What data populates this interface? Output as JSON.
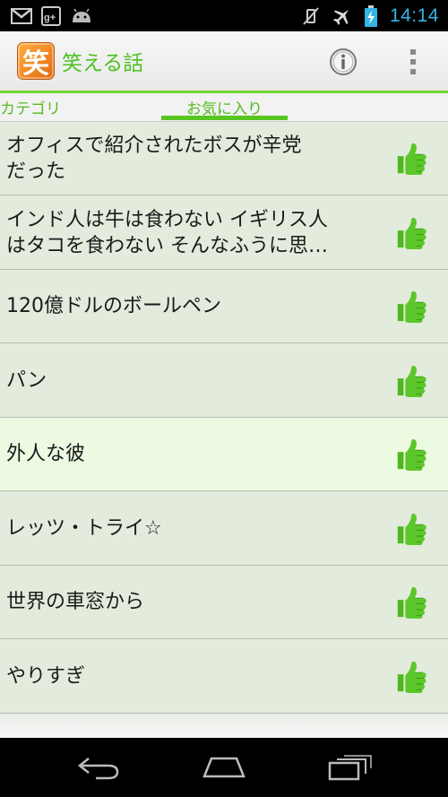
{
  "status_bar": {
    "time": "14:14",
    "left_icons": [
      "gmail-icon",
      "google-plus-icon",
      "android-icon"
    ],
    "right_icons": [
      "vibrate-mute-icon",
      "airplane-mode-icon",
      "battery-charging-icon"
    ]
  },
  "action_bar": {
    "logo_char": "笑",
    "title": "笑える話",
    "info_icon": "info-icon",
    "overflow_icon": "overflow-menu-icon"
  },
  "tabs": [
    {
      "label": "カテゴリ",
      "selected": false
    },
    {
      "label": "お気に入り",
      "selected": true
    }
  ],
  "favorites": [
    {
      "title": "オフィスで紹介されたボスが辛党\nだった",
      "icon": "thumbs-up-icon"
    },
    {
      "title": "インド人は牛は食わない イギリス人\nはタコを食わない そんなふうに思…",
      "icon": "thumbs-up-icon"
    },
    {
      "title": "120億ドルのボールペン",
      "icon": "thumbs-up-icon"
    },
    {
      "title": "パン",
      "icon": "thumbs-up-icon"
    },
    {
      "title": "外人な彼",
      "icon": "thumbs-up-icon",
      "selected": true
    },
    {
      "title": "レッツ・トライ☆",
      "icon": "thumbs-up-icon"
    },
    {
      "title": "世界の車窓から",
      "icon": "thumbs-up-icon"
    },
    {
      "title": "やりすぎ",
      "icon": "thumbs-up-icon"
    }
  ],
  "nav_bar": {
    "buttons": [
      "back-icon",
      "home-icon",
      "recent-apps-icon"
    ]
  },
  "colors": {
    "accent_green": "#4cc21d",
    "thumb_green": "#5cc72a",
    "list_background": "#e2ebdc",
    "selected_row": "#ecfae2",
    "clock_blue": "#33b5e5"
  }
}
